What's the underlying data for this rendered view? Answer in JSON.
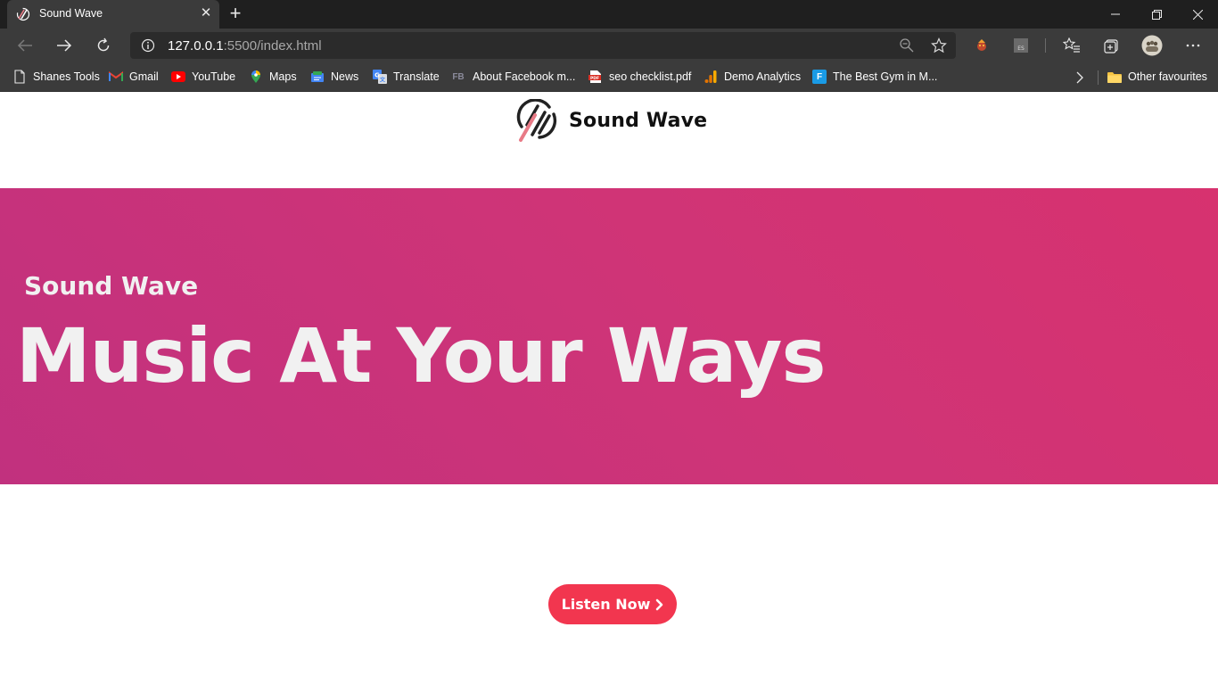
{
  "browser": {
    "tab_title": "Sound Wave",
    "address": {
      "host": "127.0.0.1",
      "path": ":5500/index.html"
    },
    "bookmarks": [
      {
        "label": "Shanes Tools",
        "icon": "page-icon"
      },
      {
        "label": "Gmail",
        "icon": "gmail-icon"
      },
      {
        "label": "YouTube",
        "icon": "youtube-icon"
      },
      {
        "label": "Maps",
        "icon": "maps-icon"
      },
      {
        "label": "News",
        "icon": "news-icon"
      },
      {
        "label": "Translate",
        "icon": "translate-icon"
      },
      {
        "label": "About Facebook m...",
        "icon": "fb-icon",
        "icon_text": "FB"
      },
      {
        "label": "seo checklist.pdf",
        "icon": "pdf-icon"
      },
      {
        "label": "Demo Analytics",
        "icon": "analytics-icon"
      },
      {
        "label": "The Best Gym in M...",
        "icon": "f-icon",
        "icon_text": "F"
      }
    ],
    "other_favourites": "Other favourites"
  },
  "site": {
    "brand": "Sound Wave",
    "hero": {
      "eyebrow": "Sound Wave",
      "title": "Music At Your Ways"
    },
    "cta_label": "Listen Now"
  },
  "colors": {
    "hero_start": "#c1317e",
    "hero_end": "#d7326f",
    "cta": "#f2364f",
    "logo_dark": "#222222",
    "logo_accent": "#e87a86"
  }
}
